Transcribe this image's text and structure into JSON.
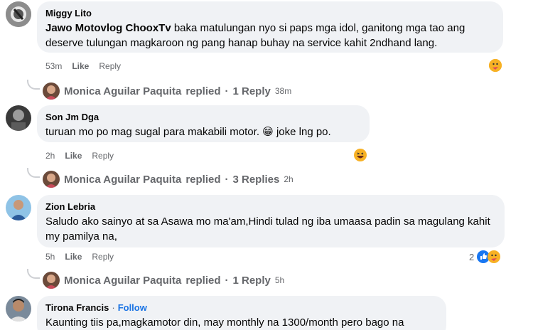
{
  "comments": [
    {
      "author": "Miggy Lito",
      "mention": "Jawo Motovlog ChooxTv",
      "text": " baka matulungan nyo si paps mga idol, ganitong mga tao ang deserve tulungan magkaroon ng pang hanap buhay na service kahit 2ndhand lang.",
      "time": "53m",
      "like": "Like",
      "reply": "Reply",
      "replies": {
        "name": "Monica Aguilar Paquita",
        "label": "replied",
        "count": "1 Reply",
        "time": "38m"
      }
    },
    {
      "author": "Son Jm Dga",
      "text": "turuan mo po mag sugal para makabili motor. 😁 joke lng po.",
      "time": "2h",
      "like": "Like",
      "reply": "Reply",
      "replies": {
        "name": "Monica Aguilar Paquita",
        "label": "replied",
        "count": "3 Replies",
        "time": "2h"
      }
    },
    {
      "author": "Zion Lebria",
      "text": "Saludo ako sainyo at sa Asawa mo ma'am,Hindi tulad ng iba umaasa padin sa magulang kahit my pamilya na,",
      "time": "5h",
      "like": "Like",
      "reply": "Reply",
      "reaction_count": "2",
      "replies": {
        "name": "Monica Aguilar Paquita",
        "label": "replied",
        "count": "1 Reply",
        "time": "5h"
      }
    },
    {
      "author": "Tirona Francis",
      "separator": "·",
      "follow": "Follow",
      "text": "Kaunting tiis pa,magkamotor din, may monthly na 1300/month pero bago na"
    }
  ],
  "reply_separator": "·",
  "colors": {
    "bubble": "#f0f2f5",
    "meta": "#65676b",
    "follow": "#1b74e4",
    "like_blue": "#1877f2",
    "haha": "#f7b125"
  },
  "icons": {
    "care": "care-reaction-icon",
    "haha": "haha-reaction-icon",
    "like": "like-reaction-icon"
  }
}
